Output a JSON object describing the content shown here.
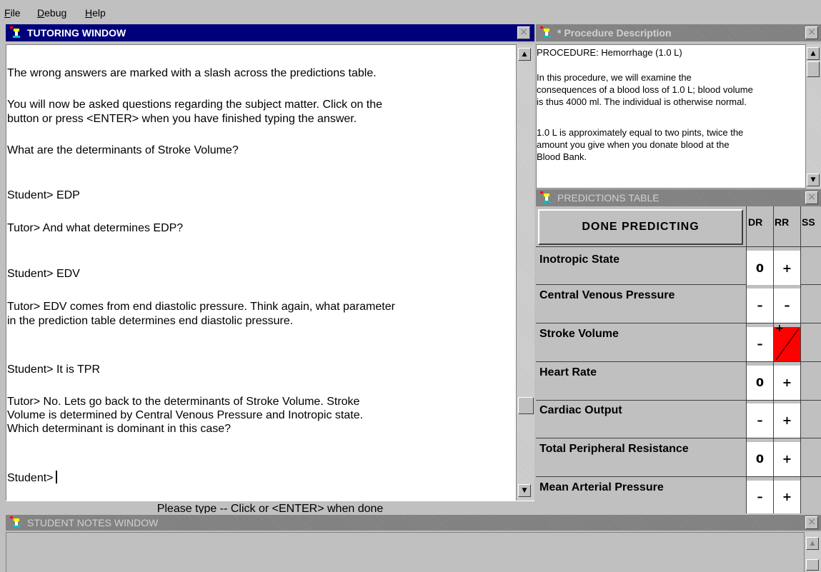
{
  "menu": {
    "file": "ile",
    "file_u": "F",
    "debug": "ebug",
    "debug_u": "D",
    "help": "elp",
    "help_u": "H"
  },
  "tutoring": {
    "title": "TUTORING WINDOW",
    "lines": [
      "The wrong answers are marked with a slash across the predictions table.",
      "You will now be asked questions regarding the subject matter. Click on the",
      "button or press <ENTER> when you have finished typing the answer.",
      "What are the determinants of Stroke Volume?",
      "Student> EDP",
      "Tutor> And what determines EDP?",
      "Student> EDV",
      "Tutor> EDV comes from end diastolic pressure. Think again, what parameter",
      "in the prediction table determines end diastolic pressure.",
      "Student> It is TPR",
      "Tutor>  No. Lets go back to the determinants of Stroke Volume.   Stroke",
      "Volume is determined by Central Venous Pressure and Inotropic state.",
      "Which determinant is dominant in this case?",
      "Student>"
    ],
    "status": "Please type -- Click or <ENTER> when done"
  },
  "procedure": {
    "title": "* Procedure Description",
    "lines": [
      "PROCEDURE:   Hemorrhage (1.0 L)",
      "In this procedure, we will examine the",
      "consequences of a blood loss of 1.0 L; blood volume",
      "is thus 4000 ml. The individual is otherwise normal.",
      "1.0 L is approximately equal to two pints, twice the",
      "amount you give when you donate blood at the",
      "Blood Bank."
    ]
  },
  "predictions": {
    "title": "PREDICTIONS TABLE",
    "done_label": "DONE PREDICTING",
    "columns": [
      "DR",
      "RR",
      "SS"
    ],
    "rows": [
      {
        "label": "Inotropic State",
        "dr": "0",
        "rr": "+"
      },
      {
        "label": "Central Venous Pressure",
        "dr": "–",
        "rr": "–"
      },
      {
        "label": "Stroke Volume",
        "dr": "–",
        "rr": "+"
      },
      {
        "label": "Heart Rate",
        "dr": "0",
        "rr": "+"
      },
      {
        "label": "Cardiac Output",
        "dr": "–",
        "rr": "+"
      },
      {
        "label": "Total Peripheral Resistance",
        "dr": "0",
        "rr": "+"
      },
      {
        "label": "Mean Arterial Pressure",
        "dr": "–",
        "rr": "+"
      }
    ],
    "wrong_color": "#ff0000"
  },
  "notes": {
    "title": "STUDENT NOTES WINDOW"
  },
  "icons": {
    "window": "app-icon",
    "close": "close-icon"
  },
  "colors": {
    "active_title": "#00007b",
    "face": "#c0c0c0"
  }
}
